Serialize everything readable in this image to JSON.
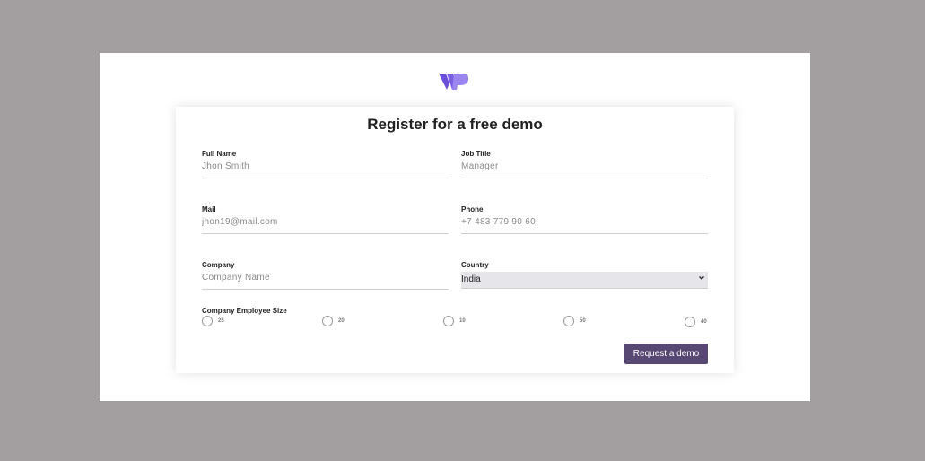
{
  "brand": {
    "logo_icon": "wp-logo-icon",
    "logo_colors": [
      "#6c4fd8",
      "#9b86ef"
    ]
  },
  "form": {
    "title": "Register for a free demo",
    "fields": {
      "full_name": {
        "label": "Full Name",
        "placeholder": "Jhon Smith",
        "value": ""
      },
      "job_title": {
        "label": "Job Title",
        "placeholder": "Manager",
        "value": ""
      },
      "mail": {
        "label": "Mail",
        "placeholder": "jhon19@mail.com",
        "value": ""
      },
      "phone": {
        "label": "Phone",
        "placeholder": "+7 483 779 90 60",
        "value": ""
      },
      "company": {
        "label": "Company",
        "placeholder": "Company Name",
        "value": ""
      },
      "country": {
        "label": "Country",
        "selected": "India",
        "icon": "chevron-down-icon"
      }
    },
    "employee_size": {
      "label": "Company Employee Size",
      "options": [
        "25",
        "20",
        "10",
        "50",
        "40"
      ],
      "selected": null
    },
    "submit_label": "Request a demo"
  },
  "colors": {
    "page_background": "#a39e9f",
    "button": "#574873",
    "select_background": "#e6e5ea"
  }
}
